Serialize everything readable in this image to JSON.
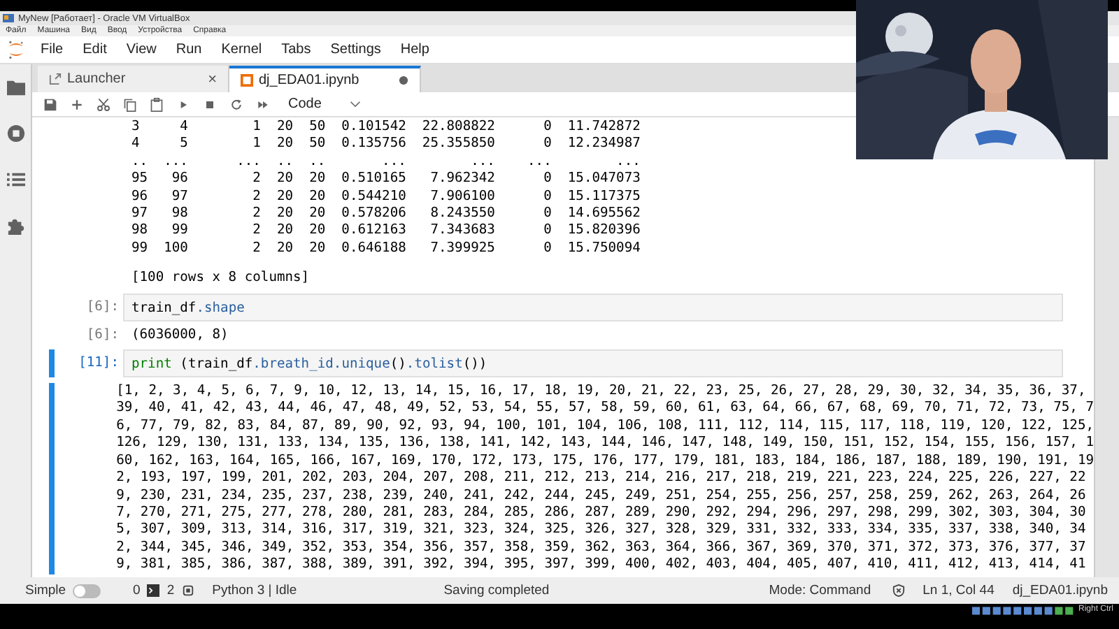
{
  "vm_window": {
    "title": "MyNew [Работает] - Oracle VM VirtualBox",
    "menu": [
      "Файл",
      "Машина",
      "Вид",
      "Ввод",
      "Устройства",
      "Справка"
    ],
    "host_key": "Right Ctrl"
  },
  "menubar": [
    "File",
    "Edit",
    "View",
    "Run",
    "Kernel",
    "Tabs",
    "Settings",
    "Help"
  ],
  "tabs": [
    {
      "label": "Launcher",
      "selected": false,
      "dirty": false,
      "close_symbol": "×"
    },
    {
      "label": "dj_EDA01.ipynb",
      "selected": true,
      "dirty": true
    }
  ],
  "toolbar": {
    "cell_type": "Code"
  },
  "cells": [
    {
      "kind": "output",
      "lines": [
        "3     4        1  20  50  0.101542  22.808822      0  11.742872",
        "4     5        1  20  50  0.135756  25.355850      0  12.234987",
        "..  ...      ...  ..  ..       ...        ...    ...        ...",
        "95   96        2  20  20  0.510165   7.962342      0  15.047073",
        "96   97        2  20  20  0.544210   7.906100      0  15.117375",
        "97   98        2  20  20  0.578206   8.243550      0  14.695562",
        "98   99        2  20  20  0.612163   7.343683      0  15.820396",
        "99  100        2  20  20  0.646188   7.399925      0  15.750094"
      ],
      "footer": "[100 rows x 8 columns]"
    },
    {
      "kind": "input",
      "active": false,
      "prompt": "[6]:",
      "tokens": [
        {
          "text": "train_df",
          "kind": "name"
        },
        {
          "text": ".shape",
          "kind": "attr"
        }
      ]
    },
    {
      "kind": "output",
      "active": false,
      "prompt": "[6]:",
      "lines": [
        "(6036000, 8)"
      ]
    },
    {
      "kind": "input",
      "active": true,
      "prompt": "[11]:",
      "tokens": [
        {
          "text": "print",
          "kind": "builtin"
        },
        {
          "text": " (train_df",
          "kind": "name"
        },
        {
          "text": ".breath_id.unique",
          "kind": "attr"
        },
        {
          "text": "()",
          "kind": "name"
        },
        {
          "text": ".tolist",
          "kind": "attr"
        },
        {
          "text": "())",
          "kind": "name"
        }
      ]
    },
    {
      "kind": "output",
      "active": true,
      "lines": [
        "[1, 2, 3, 4, 5, 6, 7, 9, 10, 12, 13, 14, 15, 16, 17, 18, 19, 20, 21, 22, 23, 25, 26, 27, 28, 29, 30, 32, 34, 35, 36, 37,",
        "39, 40, 41, 42, 43, 44, 46, 47, 48, 49, 52, 53, 54, 55, 57, 58, 59, 60, 61, 63, 64, 66, 67, 68, 69, 70, 71, 72, 73, 75, 7",
        "6, 77, 79, 82, 83, 84, 87, 89, 90, 92, 93, 94, 100, 101, 104, 106, 108, 111, 112, 114, 115, 117, 118, 119, 120, 122, 125,",
        "126, 129, 130, 131, 133, 134, 135, 136, 138, 141, 142, 143, 144, 146, 147, 148, 149, 150, 151, 152, 154, 155, 156, 157, 1",
        "60, 162, 163, 164, 165, 166, 167, 169, 170, 172, 173, 175, 176, 177, 179, 181, 183, 184, 186, 187, 188, 189, 190, 191, 19",
        "2, 193, 197, 199, 201, 202, 203, 204, 207, 208, 211, 212, 213, 214, 216, 217, 218, 219, 221, 223, 224, 225, 226, 227, 22",
        "9, 230, 231, 234, 235, 237, 238, 239, 240, 241, 242, 244, 245, 249, 251, 254, 255, 256, 257, 258, 259, 262, 263, 264, 26",
        "7, 270, 271, 275, 277, 278, 280, 281, 283, 284, 285, 286, 287, 289, 290, 292, 294, 296, 297, 298, 299, 302, 303, 304, 30",
        "5, 307, 309, 313, 314, 316, 317, 319, 321, 323, 324, 325, 326, 327, 328, 329, 331, 332, 333, 334, 335, 337, 338, 340, 34",
        "2, 344, 345, 346, 349, 352, 353, 354, 356, 357, 358, 359, 362, 363, 364, 366, 367, 369, 370, 371, 372, 373, 376, 377, 37",
        "9, 381, 385, 386, 387, 388, 389, 391, 392, 394, 395, 397, 399, 400, 402, 403, 404, 405, 407, 410, 411, 412, 413, 414, 41"
      ]
    }
  ],
  "status_bar": {
    "simple_label": "Simple",
    "simple_on": false,
    "terminals": "0",
    "kernels": "2",
    "kernel_status": "Python 3 | Idle",
    "message": "Saving completed",
    "mode": "Mode: Command",
    "position": "Ln 1, Col 44",
    "file": "dj_EDA01.ipynb"
  }
}
